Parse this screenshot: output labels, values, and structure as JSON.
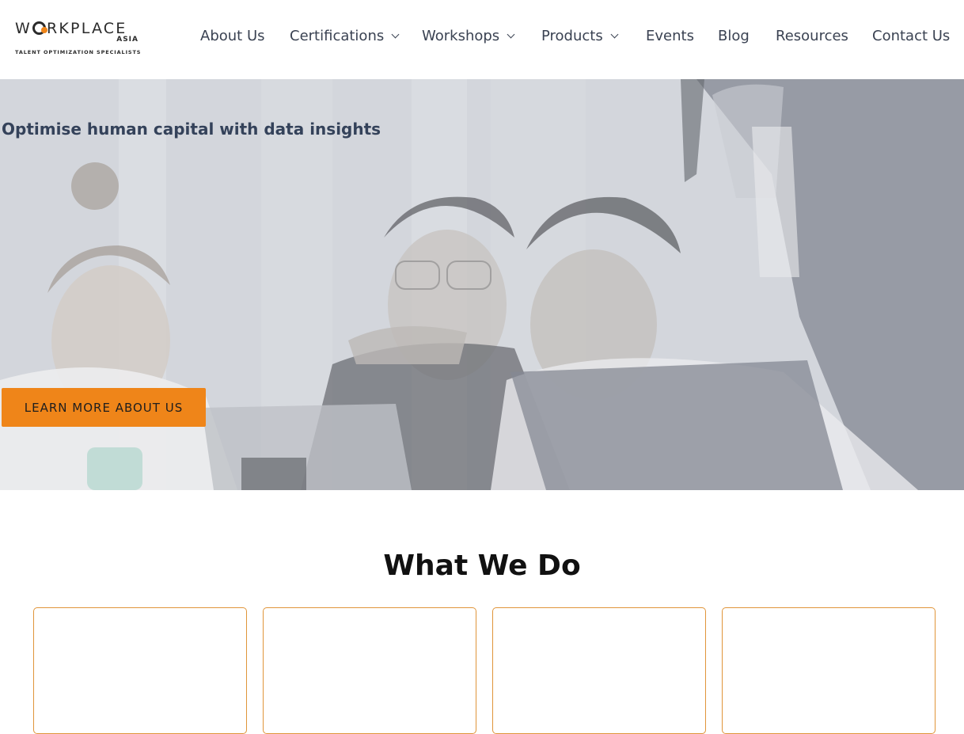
{
  "brand": {
    "logo_word": "WORKPLACE",
    "logo_sub": "ASIA",
    "logo_tagline": "TALENT OPTIMIZATION SPECIALISTS",
    "accent_color": "#ef8519"
  },
  "nav": {
    "items": [
      {
        "label": "About Us",
        "dropdown": false
      },
      {
        "label": "Certifications",
        "dropdown": true
      },
      {
        "label": "Workshops",
        "dropdown": true
      },
      {
        "label": "Products",
        "dropdown": true
      },
      {
        "label": "Events",
        "dropdown": false
      },
      {
        "label": "Blog",
        "dropdown": false
      },
      {
        "label": "Resources",
        "dropdown": false
      },
      {
        "label": "Contact Us",
        "dropdown": false
      }
    ]
  },
  "hero": {
    "title": "Optimise human capital with data insights",
    "button_label": "LEARN MORE ABOUT US"
  },
  "what_we_do": {
    "title": "What We Do",
    "cards": [
      {},
      {},
      {},
      {}
    ]
  }
}
